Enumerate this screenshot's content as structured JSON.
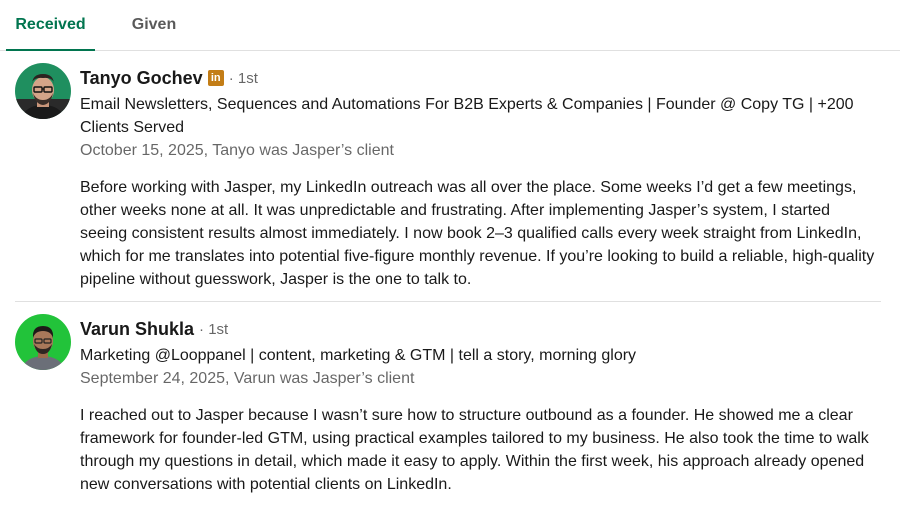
{
  "tabs": {
    "received": "Received",
    "given": "Given"
  },
  "colors": {
    "accent": "#01754f",
    "badge": "#c37d16",
    "avatar2_bg": "#22c33a"
  },
  "recommendations": [
    {
      "avatar_icon": "profile-photo",
      "name": "Tanyo Gochev",
      "badge_icon": "linkedin-badge-icon",
      "badge_text": "in",
      "degree": "· 1st",
      "headline": "Email Newsletters, Sequences and Automations For B2B Experts & Companies | Founder @ Copy TG | +200 Clients Served",
      "meta": "October 15, 2025, Tanyo was Jasper’s client",
      "text": "Before working with Jasper, my LinkedIn outreach was all over the place. Some weeks I’d get a few meetings, other weeks none at all. It was unpredictable and frustrating. After implementing Jasper’s system, I started seeing consistent results almost immediately. I now book 2–3 qualified calls every week straight from LinkedIn, which for me translates into potential five-figure monthly revenue. If you’re looking to build a reliable, high-quality pipeline without guesswork, Jasper is the one to talk to."
    },
    {
      "avatar_icon": "profile-photo",
      "name": "Varun Shukla",
      "degree": "· 1st",
      "headline": "Marketing @Looppanel | content, marketing & GTM | tell a story, morning glory",
      "meta": "September 24, 2025, Varun was Jasper’s client",
      "text": "I reached out to Jasper because I wasn’t sure how to structure outbound as a founder. He showed me a clear framework for founder-led GTM, using practical examples tailored to my business. He also took the time to walk through my questions in detail, which made it easy to apply. Within the first week, his approach already opened new conversations with potential clients on LinkedIn."
    }
  ]
}
